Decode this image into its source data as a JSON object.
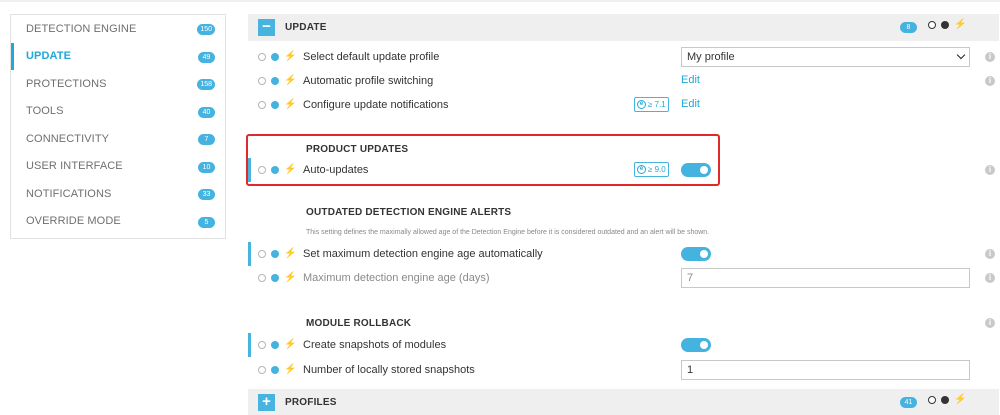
{
  "sidebar": {
    "items": [
      {
        "label": "DETECTION ENGINE",
        "count": "150",
        "active": false
      },
      {
        "label": "UPDATE",
        "count": "49",
        "active": true
      },
      {
        "label": "PROTECTIONS",
        "count": "158",
        "active": false
      },
      {
        "label": "TOOLS",
        "count": "40",
        "active": false
      },
      {
        "label": "CONNECTIVITY",
        "count": "7",
        "active": false
      },
      {
        "label": "USER INTERFACE",
        "count": "10",
        "active": false
      },
      {
        "label": "NOTIFICATIONS",
        "count": "33",
        "active": false
      },
      {
        "label": "OVERRIDE MODE",
        "count": "5",
        "active": false
      }
    ]
  },
  "update_section": {
    "toggle_symbol": "−",
    "title": "UPDATE",
    "count": "8",
    "rows": {
      "profile": {
        "label": "Select default update profile",
        "value": "My profile"
      },
      "switching": {
        "label": "Automatic profile switching",
        "action": "Edit"
      },
      "notifications": {
        "label": "Configure update notifications",
        "version": "≥ 7.1",
        "action": "Edit"
      }
    },
    "product_updates": {
      "title": "PRODUCT UPDATES",
      "auto_updates": {
        "label": "Auto-updates",
        "version": "≥ 9.0",
        "enabled": true
      }
    },
    "outdated": {
      "title": "OUTDATED DETECTION ENGINE ALERTS",
      "description": "This setting defines the maximally allowed age of the Detection Engine before it is considered outdated and an alert will be shown.",
      "auto_age": {
        "label": "Set maximum detection engine age automatically",
        "enabled": true
      },
      "max_age": {
        "label": "Maximum detection engine age (days)",
        "value": "7"
      }
    },
    "rollback": {
      "title": "MODULE ROLLBACK",
      "snapshots": {
        "label": "Create snapshots of modules",
        "enabled": true
      },
      "stored": {
        "label": "Number of locally stored snapshots",
        "value": "1"
      }
    }
  },
  "profiles_section": {
    "toggle_symbol": "+",
    "title": "PROFILES",
    "count": "41"
  },
  "icons": {
    "info": "i",
    "version_mark": "e",
    "bolt": "⚡"
  },
  "colors": {
    "accent": "#45b3e0",
    "highlight": "#e02a2a"
  }
}
